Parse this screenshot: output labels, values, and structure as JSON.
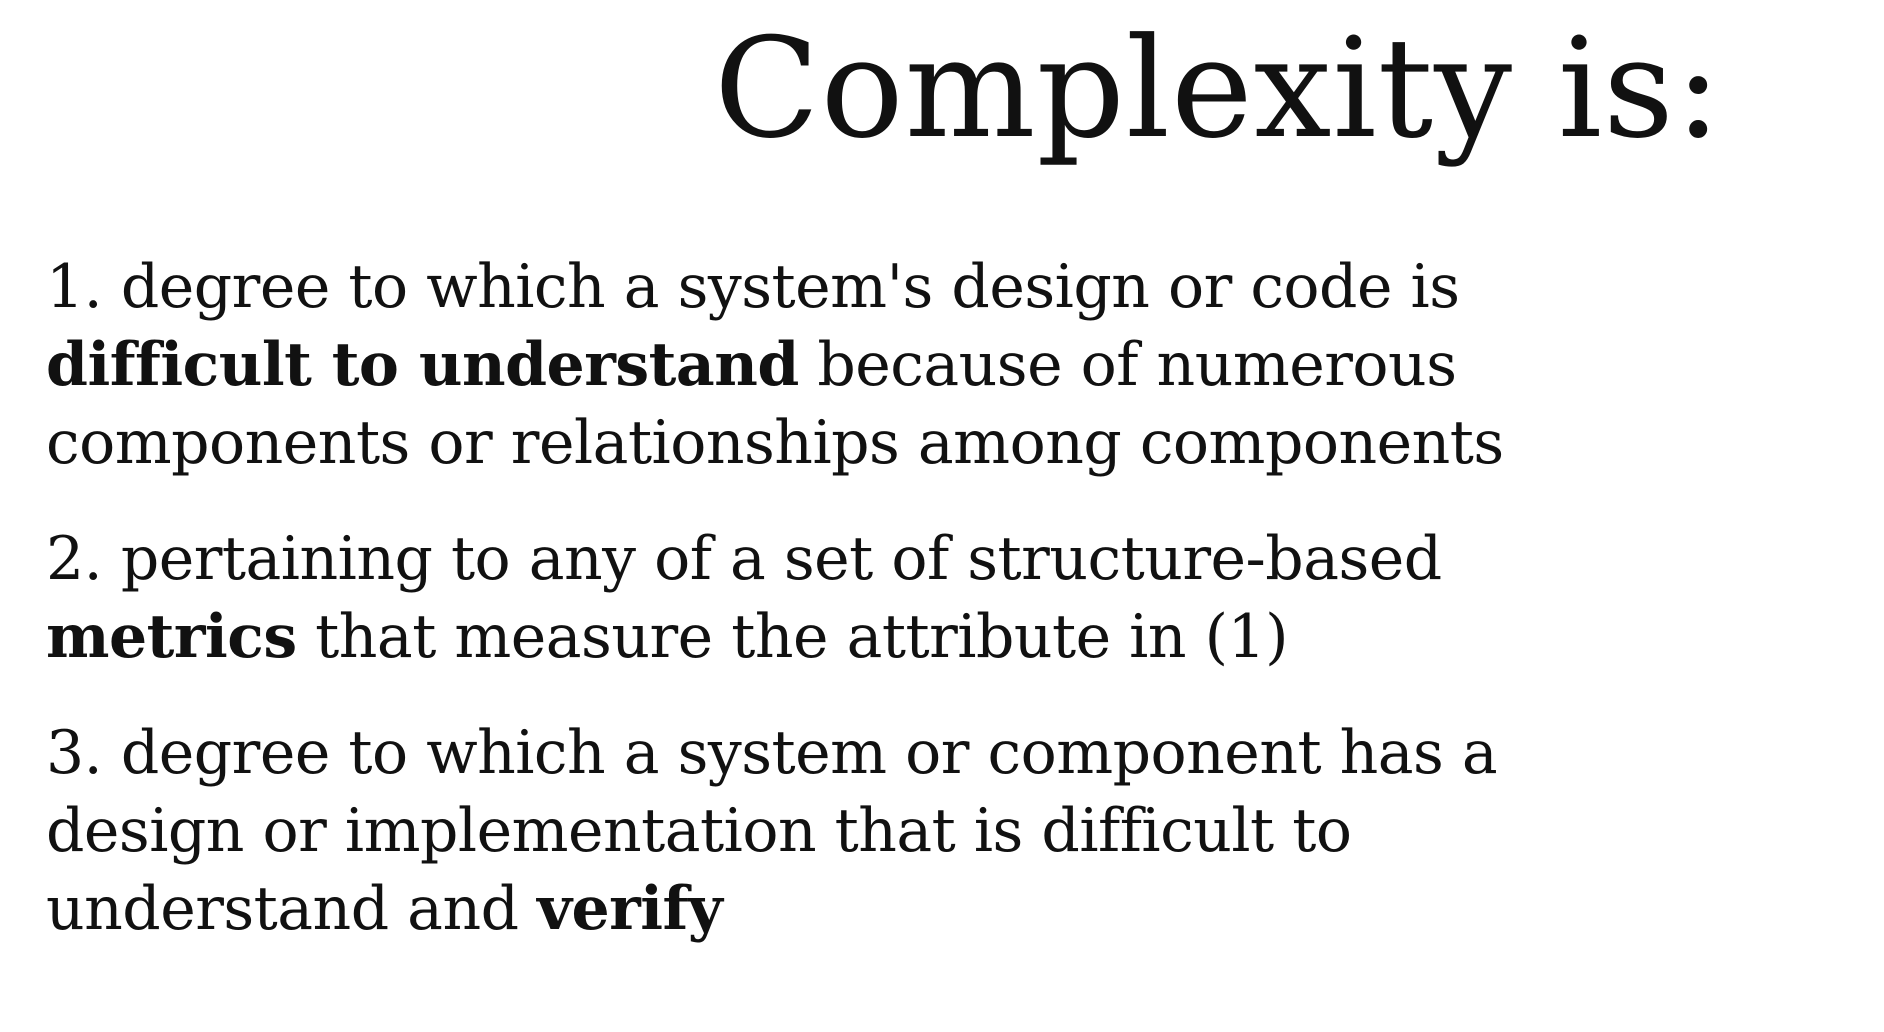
{
  "slide": {
    "title": "Complexity is:",
    "definitions": [
      {
        "lines": [
          {
            "parts": [
              "1. degree to which a system's design or code is"
            ]
          },
          {
            "bold": "difficult to understand",
            "rest": " because of numerous"
          },
          {
            "parts": [
              "components or relationships among components"
            ]
          }
        ]
      },
      {
        "lines": [
          {
            "parts": [
              "2. pertaining to any of a set of structure-based"
            ]
          },
          {
            "bold": "metrics",
            "rest": " that measure the attribute in (1)"
          }
        ]
      },
      {
        "lines": [
          {
            "parts": [
              "3. degree to which a system or component has a"
            ]
          },
          {
            "parts": [
              "design or implementation that is difficult to"
            ]
          },
          {
            "pre": "understand and ",
            "bold": "verify"
          }
        ]
      }
    ]
  }
}
